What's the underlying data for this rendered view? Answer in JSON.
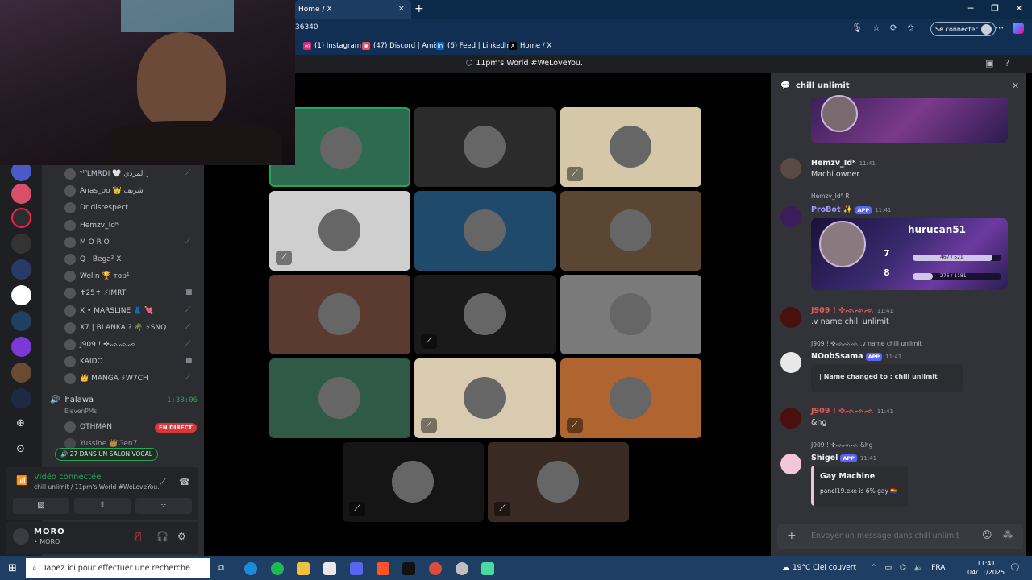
{
  "browser": {
    "active_tab": "Home / X",
    "url_fragment": "36340",
    "connect_label": "Se connecter",
    "bookmarks": [
      "(1) Instagram",
      "(47) Discord | Amis",
      "(6) Feed | LinkedIn",
      "Home / X"
    ]
  },
  "server": {
    "title": "11pm's World #WeLoveYou."
  },
  "members": [
    {
      "name": "ᵛᴵᴾLMRDI 🤍 ﮼ﺍﻟﻤﺮﺩﻱ",
      "muted": true
    },
    {
      "name": "Anas_oo 👑 شريف",
      "muted": false
    },
    {
      "name": "Dr disrespect",
      "muted": false
    },
    {
      "name": "Hemzv_Idᴿ",
      "muted": false
    },
    {
      "name": "M O R O",
      "muted": true
    },
    {
      "name": "Q | Bega² X",
      "muted": false
    },
    {
      "name": "Welln 🏆 тор¹",
      "muted": false
    },
    {
      "name": "✝25✝ ⚡IMRT",
      "muted": false,
      "camera": true
    },
    {
      "name": "X • MARSLINE 👗 💘",
      "muted": true
    },
    {
      "name": "X7 | BLANKA ? 🌴 ⚡SNQ",
      "muted": true
    },
    {
      "name": "J909 ! ✜ᨒᨒᨒ",
      "muted": true
    },
    {
      "name": "KAIDO",
      "muted": false,
      "camera": true
    },
    {
      "name": "👑 MANGA ⚡W7CH",
      "muted": true
    }
  ],
  "voice": {
    "channel": "halawa",
    "time": "1:38:06",
    "sub": "ElevenPMs",
    "member_live": "OTHMAN",
    "live_label": "EN DIRECT",
    "member_partial": "Yussine 👑Gen7",
    "pill": "27 DANS UN SALON VOCAL",
    "status": "Vidéo connectée",
    "status_sub": "chill unlimit / 11pm's World #WeLoveYou."
  },
  "user": {
    "name": "MORO",
    "status": "• MORO"
  },
  "thread": {
    "title": "chill unlimit",
    "input_placeholder": "Envoyer un message dans chill unlimit"
  },
  "messages": [
    {
      "user": "Hemzv_Idᴿ",
      "time": "11:41",
      "text": "Machi owner"
    },
    {
      "reply": "Hemzv_Idᴿ R",
      "user": "ProBot ✨",
      "app": "APP",
      "time": "11:41",
      "card_user": "hurucan51",
      "lvl1": "7",
      "lvl2": "8",
      "xp1": "467 / 521",
      "xp2": "276 / 1181"
    },
    {
      "user": "J909 ! ✜ᨒᨒᨒ",
      "time": "11:41",
      "text": ".v name chill unlimit"
    },
    {
      "reply": "J909 ! ✜ᨒᨒᨒ .v name chill unlimit",
      "user": "NOobSsama",
      "app": "APP",
      "time": "11:41",
      "embed": "| Name changed to : chill unlimit"
    },
    {
      "user": "J909 ! ✜ᨒᨒᨒ",
      "time": "11:41",
      "text": "&hg"
    },
    {
      "reply": "J909 ! ✜ᨒᨒᨒ &hg",
      "user": "Shigel",
      "app": "APP",
      "time": "11:41",
      "embed_title": "Gay Machine",
      "embed_text": "panel19.exe is 6% gay 🏳️‍🌈"
    }
  ],
  "taskbar": {
    "search_placeholder": "Tapez ici pour effectuer une recherche",
    "weather": "19°C  Ciel couvert",
    "lang": "FRA",
    "time": "11:41",
    "date": "04/11/2025"
  },
  "tiles": [
    {
      "bg": "#2d6a4f",
      "muted": false
    },
    {
      "bg": "#2b2b2b",
      "muted": false
    },
    {
      "bg": "#d5c8a8",
      "muted": true
    },
    {
      "bg": "#cfcfcf",
      "muted": true
    },
    {
      "bg": "#1f4a6b",
      "muted": false
    },
    {
      "bg": "#5a4632",
      "muted": false
    },
    {
      "bg": "#5b3a30",
      "muted": false
    },
    {
      "bg": "#1a1a1a",
      "muted": true
    },
    {
      "bg": "#7a7a7a",
      "muted": false
    },
    {
      "bg": "#2f5a45",
      "muted": false
    },
    {
      "bg": "#d9cbb0",
      "muted": true
    },
    {
      "bg": "#b0642f",
      "muted": true
    },
    {
      "bg": "#151515",
      "muted": true
    },
    {
      "bg": "#3a2a24",
      "muted": true
    }
  ]
}
